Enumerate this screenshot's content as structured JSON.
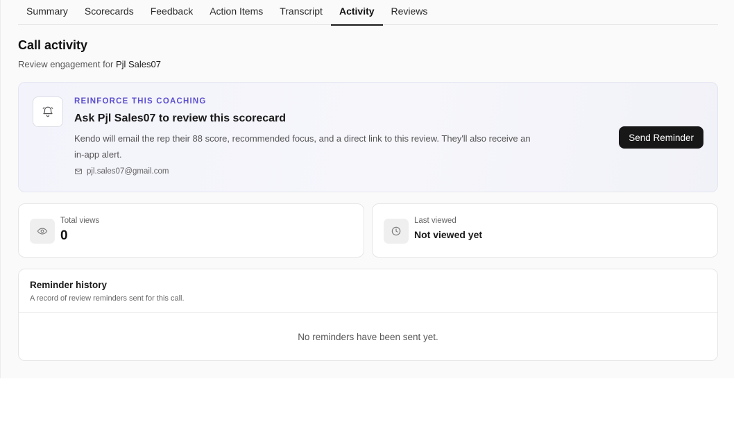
{
  "tabs": [
    {
      "label": "Summary",
      "active": false
    },
    {
      "label": "Scorecards",
      "active": false
    },
    {
      "label": "Feedback",
      "active": false
    },
    {
      "label": "Action Items",
      "active": false
    },
    {
      "label": "Transcript",
      "active": false
    },
    {
      "label": "Activity",
      "active": true
    },
    {
      "label": "Reviews",
      "active": false
    }
  ],
  "header": {
    "title": "Call activity",
    "subtitle_prefix": "Review engagement for",
    "rep_name": "Pjl Sales07"
  },
  "coaching": {
    "eyebrow": "REINFORCE THIS COACHING",
    "title": "Ask Pjl Sales07 to review this scorecard",
    "description": "Kendo will email the rep their 88 score, recommended focus, and a direct link to this review. They'll also receive an in-app alert.",
    "email": "pjl.sales07@gmail.com",
    "button_label": "Send Reminder",
    "icon": "bell-icon",
    "accent_color": "#5b4fcf"
  },
  "stats": {
    "views": {
      "label": "Total views",
      "value": "0",
      "icon": "eye-icon"
    },
    "last_viewed": {
      "label": "Last viewed",
      "value": "Not viewed yet",
      "icon": "clock-icon"
    }
  },
  "history": {
    "title": "Reminder history",
    "subtitle": "A record of review reminders sent for this call.",
    "empty_text": "No reminders have been sent yet."
  }
}
